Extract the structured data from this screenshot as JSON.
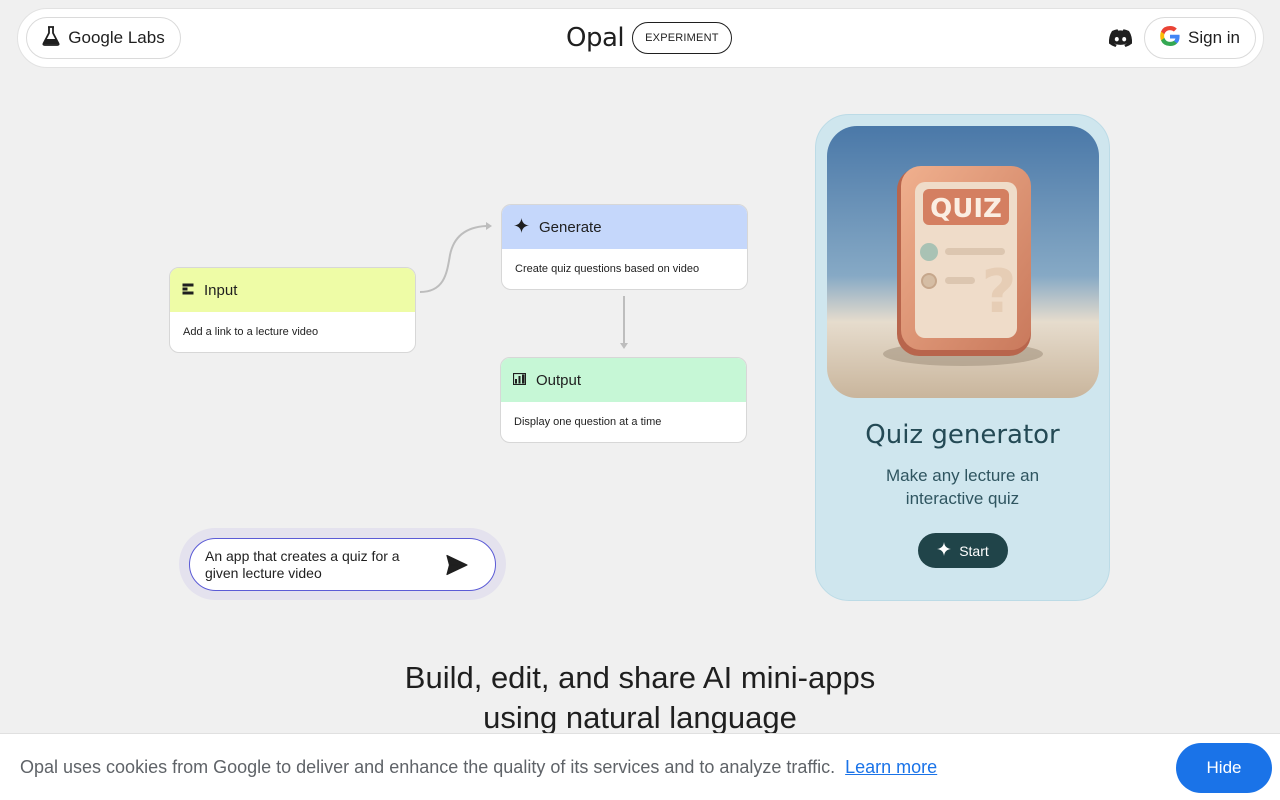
{
  "header": {
    "labs_label": "Google Labs",
    "brand": "Opal",
    "badge": "EXPERIMENT",
    "signin_label": "Sign in"
  },
  "flow": {
    "input": {
      "title": "Input",
      "desc": "Add a link to a lecture video",
      "icon": "input-icon",
      "color": "#eefca6"
    },
    "generate": {
      "title": "Generate",
      "desc": "Create quiz questions based on video",
      "icon": "sparkle-icon",
      "color": "#c5d7fb"
    },
    "output": {
      "title": "Output",
      "desc": "Display one question at a time",
      "icon": "output-icon",
      "color": "#c6f7d6"
    }
  },
  "prompt": {
    "text": "An app that creates a quiz for a given lecture video"
  },
  "preview": {
    "image_label": "QUIZ",
    "title": "Quiz generator",
    "subtitle": "Make any lecture an interactive quiz",
    "start_label": "Start"
  },
  "headline": {
    "line1": "Build, edit, and share AI mini-apps",
    "line2": "using natural language"
  },
  "cookie": {
    "text": "Opal uses cookies from Google to deliver and enhance the quality of its services and to analyze traffic.",
    "link": "Learn more",
    "hide_label": "Hide"
  },
  "colors": {
    "accent_blue": "#1a73e8",
    "start_button": "#204449",
    "preview_bg": "#cfe6ee"
  }
}
